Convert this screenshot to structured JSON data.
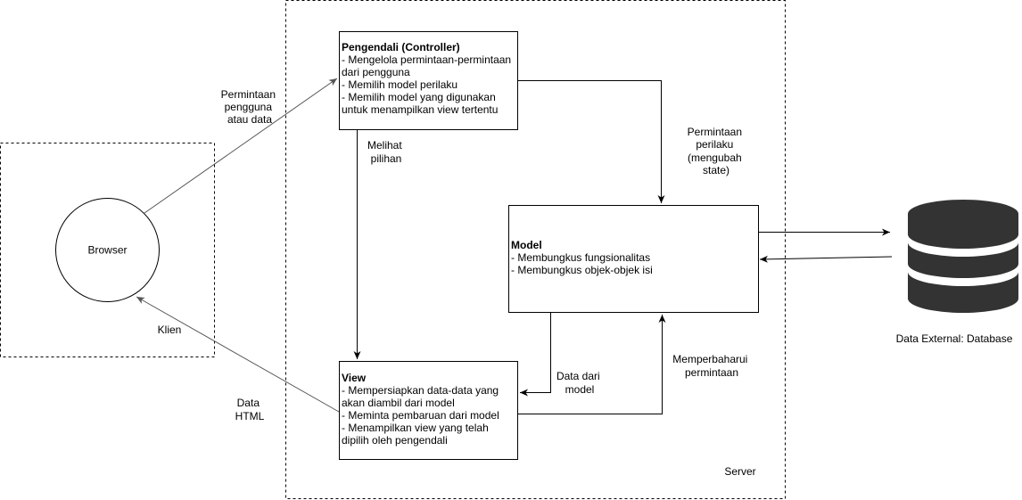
{
  "containers": {
    "client_label": "Klien",
    "server_label": "Server"
  },
  "browser": {
    "label": "Browser"
  },
  "controller": {
    "title": "Pengendali (Controller)",
    "lines": [
      "- Mengelola permintaan-permintaan dari pengguna",
      "- Memilih model perilaku",
      "- Memilih model yang digunakan untuk menampilkan view tertentu"
    ]
  },
  "model": {
    "title": "Model",
    "lines": [
      "- Membungkus fungsionalitas",
      "- Membungkus objek-objek isi"
    ]
  },
  "view": {
    "title": "View",
    "lines": [
      "- Mempersiapkan data-data yang akan diambil dari model",
      "- Meminta pembaruan dari model",
      "- Menampilkan view yang telah dipilih oleh pengendali"
    ]
  },
  "database": {
    "label": "Data External: Database",
    "color": "#333333"
  },
  "edges": {
    "user_request": [
      "Permintaan",
      "pengguna",
      "atau data"
    ],
    "view_selection": [
      "Melihat",
      "pilihan"
    ],
    "behavior_request": [
      "Permintaan",
      "perilaku",
      "(mengubah",
      "state)"
    ],
    "data_from_model": [
      "Data dari",
      "model"
    ],
    "update_request": [
      "Memperbaharui",
      "permintaan"
    ],
    "html_data": [
      "Data",
      "HTML"
    ]
  },
  "colors": {
    "stroke": "#000000",
    "browser_arrow": "#555555"
  }
}
